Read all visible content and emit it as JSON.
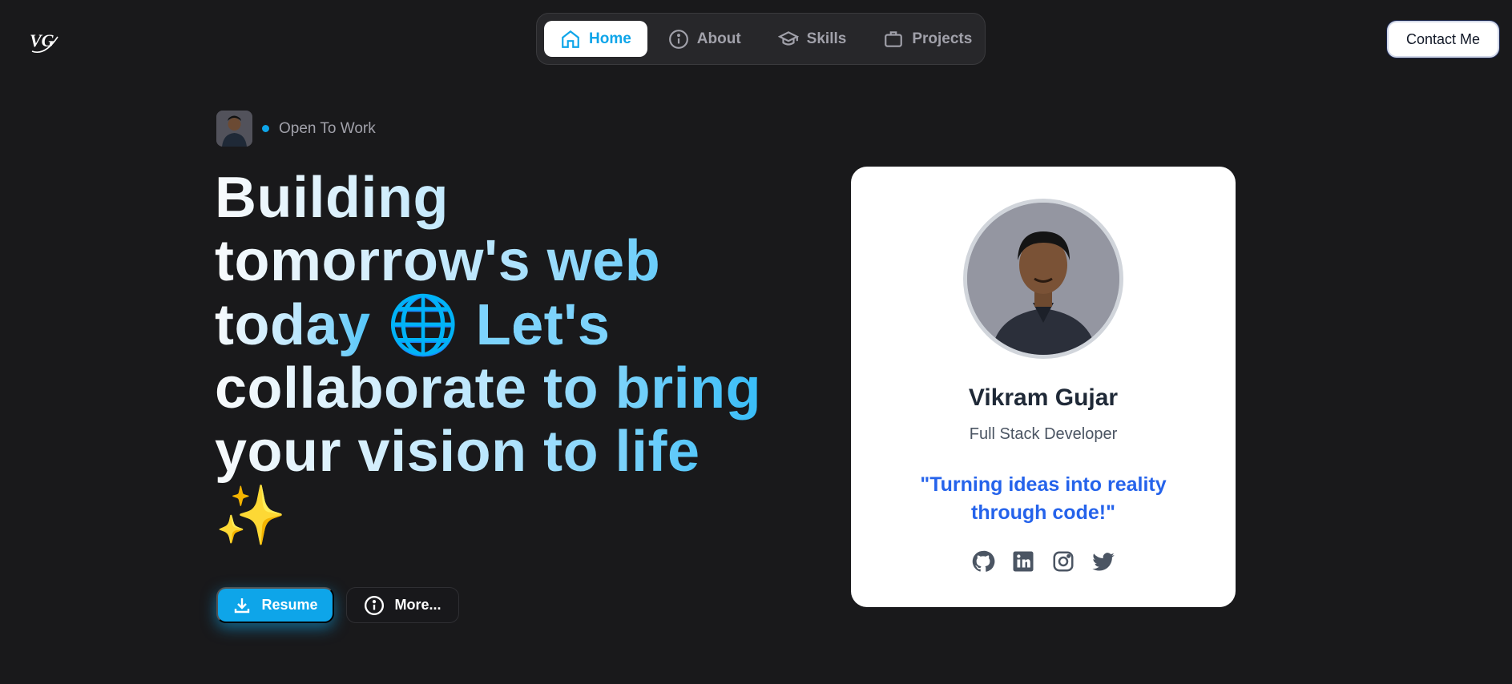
{
  "header": {
    "logo_text": "VG",
    "nav": [
      {
        "label": "Home",
        "icon": "home-icon",
        "active": true
      },
      {
        "label": "About",
        "icon": "info-icon",
        "active": false
      },
      {
        "label": "Skills",
        "icon": "graduation-cap-icon",
        "active": false
      },
      {
        "label": "Projects",
        "icon": "briefcase-icon",
        "active": false
      }
    ],
    "contact_label": "Contact Me"
  },
  "hero": {
    "status": "Open To Work",
    "headline": {
      "line1": "Building",
      "line2": "tomorrow's web",
      "line3a": "today ",
      "line3_emoji": "🌐",
      "line3b": " Let's",
      "line4": "collaborate to bring",
      "line5": "your vision to life",
      "line6_emoji": "✨"
    },
    "resume_label": "Resume",
    "more_label": "More..."
  },
  "card": {
    "name": "Vikram Gujar",
    "role": "Full Stack Developer",
    "quote": "\"Turning ideas into reality through code!\"",
    "socials": [
      "github-icon",
      "linkedin-icon",
      "instagram-icon",
      "twitter-icon"
    ]
  },
  "colors": {
    "accent": "#0ea5e9",
    "background": "#19191b",
    "quote": "#2563eb"
  }
}
